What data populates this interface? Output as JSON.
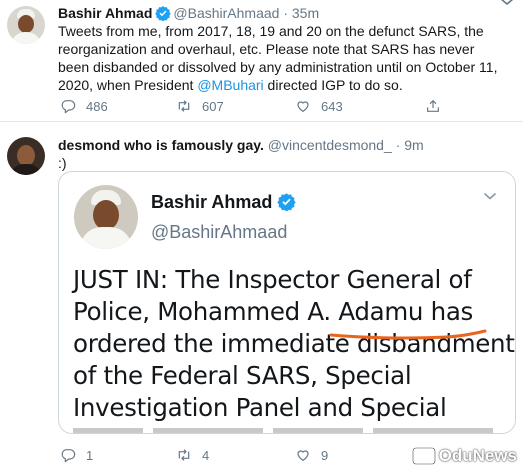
{
  "tweets": [
    {
      "name": "Bashir Ahmad",
      "handle": "@BashirAhmaad",
      "separator": "·",
      "time": "35m",
      "text_before": "Tweets from me, from 2017, 18, 19 and 20 on the defunct SARS, the reorganization and overhaul, etc. Please note that SARS has never been disbanded or dissolved by any administration until on October 11, 2020, when President ",
      "mention": "@MBuhari",
      "text_after": " directed IGP to do so.",
      "reply_count": "486",
      "retweet_count": "607",
      "like_count": "643"
    },
    {
      "name": "desmond who is famously gay.",
      "handle": "@vincentdesmond_",
      "separator": "·",
      "time": "9m",
      "text": ":)",
      "reply_count": "1",
      "retweet_count": "4",
      "like_count": "9",
      "embedded_card": {
        "name": "Bashir Ahmad",
        "handle": "@BashirAhmaad",
        "lines": [
          "JUST IN: The Inspector General of",
          "Police, Mohammed A. Adamu has",
          "ordered the immediate disbandment",
          "of the Federal SARS, Special",
          "Investigation Panel and Special"
        ]
      }
    }
  ],
  "watermark": {
    "text": "OduNews"
  },
  "colors": {
    "text": "#14171a",
    "secondary": "#657786",
    "link": "#1b95e0",
    "verified": "#1da1f2",
    "underline": "#e8651f",
    "border": "#e1e8ed"
  },
  "icons": [
    "verified-icon",
    "chevron-down-icon",
    "reply-icon",
    "retweet-icon",
    "like-icon",
    "share-icon"
  ]
}
